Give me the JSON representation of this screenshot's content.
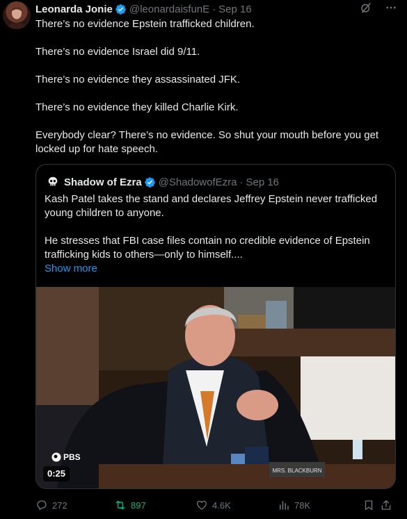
{
  "author": {
    "display_name": "Leonarda Jonie",
    "handle": "@leonardaisfunE",
    "separator": "·",
    "date": "Sep 16",
    "avatar_icon": "profile-photo-avatar"
  },
  "body": {
    "paragraphs": [
      "There’s no evidence Epstein trafficked children.",
      "There’s no evidence Israel did 9/11.",
      "There’s no evidence they assassinated JFK.",
      "There’s no evidence they killed Charlie Kirk.",
      "Everybody clear? There’s no evidence. So shut your mouth before you get locked up for hate speech."
    ]
  },
  "quoted": {
    "display_name": "Shadow of Ezra",
    "handle": "@ShadowofEzra",
    "separator": "·",
    "date": "Sep 16",
    "paragraphs": [
      "Kash Patel takes the stand and declares Jeffrey Epstein never trafficked young children to anyone.",
      "He stresses that FBI case files contain no credible evidence of Epstein trafficking kids to others—only to himself...."
    ],
    "show_more": "Show more",
    "media": {
      "duration": "0:25",
      "watermark": "PBS",
      "nameplate": "MRS. BLACKBURN"
    }
  },
  "actions": {
    "replies": "272",
    "reposts": "897",
    "likes": "4.6K",
    "views": "78K"
  },
  "colors": {
    "background": "#000000",
    "text": "#e7e9ea",
    "muted": "#71767b",
    "accent": "#1d9bf0",
    "repost_active": "#00ba7c",
    "border": "#2f3336"
  }
}
